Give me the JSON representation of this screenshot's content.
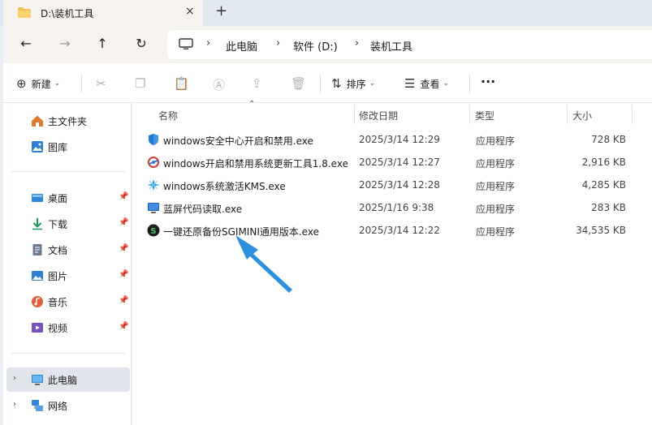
{
  "tab": {
    "title": "D:\\装机工具",
    "close_icon": "×",
    "new_tab_icon": "+"
  },
  "nav": {
    "back": "←",
    "forward": "→",
    "up": "↑",
    "refresh": "↻",
    "breadcrumb": [
      "此电脑",
      "软件 (D:)",
      "装机工具"
    ],
    "separator": "›"
  },
  "commands": {
    "new_label": "新建",
    "sort_label": "排序",
    "view_label": "查看",
    "more": "···"
  },
  "sidebar": {
    "items": [
      {
        "label": "主文件夹",
        "icon": "home-icon",
        "color": "#e07a2e",
        "pinned": false
      },
      {
        "label": "图库",
        "icon": "gallery-icon",
        "color": "#2f7fd6",
        "pinned": false
      },
      {
        "label": "桌面",
        "icon": "desktop-icon",
        "color": "#2b88d8",
        "pinned": true
      },
      {
        "label": "下载",
        "icon": "download-icon",
        "color": "#1a9a5a",
        "pinned": true
      },
      {
        "label": "文档",
        "icon": "documents-icon",
        "color": "#6b7a8f",
        "pinned": true
      },
      {
        "label": "图片",
        "icon": "pictures-icon",
        "color": "#2f7fd6",
        "pinned": true
      },
      {
        "label": "音乐",
        "icon": "music-icon",
        "color": "#e0603a",
        "pinned": true
      },
      {
        "label": "视频",
        "icon": "videos-icon",
        "color": "#7a4fc2",
        "pinned": true
      }
    ],
    "this_pc": "此电脑",
    "network": "网络"
  },
  "columns": {
    "name": "名称",
    "modified": "修改日期",
    "type": "类型",
    "size": "大小"
  },
  "files": [
    {
      "name": "windows安全中心开启和禁用.exe",
      "modified": "2025/3/14 12:29",
      "type": "应用程序",
      "size": "728 KB",
      "icon": "shield-icon"
    },
    {
      "name": "windows开启和禁用系统更新工具1.8.exe",
      "modified": "2025/3/14 12:27",
      "type": "应用程序",
      "size": "2,916 KB",
      "icon": "update-tool-icon"
    },
    {
      "name": "windows系统激活KMS.exe",
      "modified": "2025/3/14 12:28",
      "type": "应用程序",
      "size": "4,285 KB",
      "icon": "kms-star-icon"
    },
    {
      "name": "蓝屏代码读取.exe",
      "modified": "2025/1/16 9:38",
      "type": "应用程序",
      "size": "283 KB",
      "icon": "monitor-icon"
    },
    {
      "name": "一键还原备份SGIMINI通用版本.exe",
      "modified": "2025/3/14 12:22",
      "type": "应用程序",
      "size": "34,535 KB",
      "icon": "sgimini-icon"
    }
  ],
  "colors": {
    "accent": "#2b90e0",
    "arrow": "#2b90e0"
  }
}
